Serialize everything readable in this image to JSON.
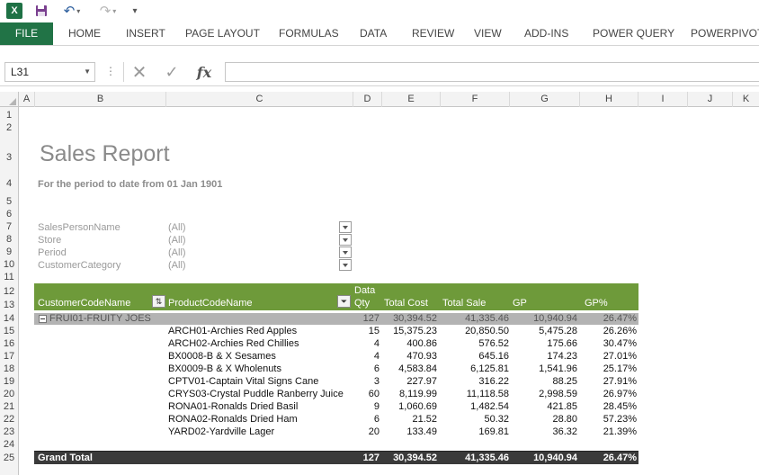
{
  "app": {
    "icon": "excel-icon",
    "excel_logo_letter": "X"
  },
  "ribbon": {
    "tabs": [
      "FILE",
      "HOME",
      "INSERT",
      "PAGE LAYOUT",
      "FORMULAS",
      "DATA",
      "REVIEW",
      "VIEW",
      "ADD-INS",
      "POWER QUERY",
      "POWERPIVOT"
    ]
  },
  "formula_bar": {
    "name_box": "L31",
    "formula": ""
  },
  "columns": [
    "A",
    "B",
    "C",
    "D",
    "E",
    "F",
    "G",
    "H",
    "I",
    "J",
    "K"
  ],
  "rows": [
    "1",
    "2",
    "3",
    "4",
    "5",
    "6",
    "7",
    "8",
    "9",
    "10",
    "11",
    "12",
    "13",
    "14",
    "15",
    "16",
    "17",
    "18",
    "19",
    "20",
    "21",
    "22",
    "23",
    "24",
    "25"
  ],
  "report": {
    "title": "Sales Report",
    "subtitle": "For the period to date from  01 Jan 1901"
  },
  "filters": [
    {
      "label": "SalesPersonName",
      "value": "(All)"
    },
    {
      "label": "Store",
      "value": "(All)"
    },
    {
      "label": "Period",
      "value": "(All)"
    },
    {
      "label": "CustomerCategory",
      "value": "(All)"
    }
  ],
  "pivot": {
    "data_label": "Data",
    "headers": {
      "customer": "CustomerCodeName",
      "product": "ProductCodeName",
      "qty": "Qty",
      "total_cost": "Total Cost",
      "total_sale": "Total Sale",
      "gp": "GP",
      "gp_pct": "GP%"
    },
    "group": {
      "name": "FRUI01-FRUITY JOES",
      "qty": "127",
      "total_cost": "30,394.52",
      "total_sale": "41,335.46",
      "gp": "10,940.94",
      "gp_pct": "26.47%"
    },
    "rows": [
      {
        "product": "ARCH01-Archies Red Apples",
        "qty": "15",
        "total_cost": "15,375.23",
        "total_sale": "20,850.50",
        "gp": "5,475.28",
        "gp_pct": "26.26%"
      },
      {
        "product": "ARCH02-Archies Red Chillies",
        "qty": "4",
        "total_cost": "400.86",
        "total_sale": "576.52",
        "gp": "175.66",
        "gp_pct": "30.47%"
      },
      {
        "product": "BX0008-B & X Sesames",
        "qty": "4",
        "total_cost": "470.93",
        "total_sale": "645.16",
        "gp": "174.23",
        "gp_pct": "27.01%"
      },
      {
        "product": "BX0009-B & X Wholenuts",
        "qty": "6",
        "total_cost": "4,583.84",
        "total_sale": "6,125.81",
        "gp": "1,541.96",
        "gp_pct": "25.17%"
      },
      {
        "product": "CPTV01-Captain Vital Signs Cane",
        "qty": "3",
        "total_cost": "227.97",
        "total_sale": "316.22",
        "gp": "88.25",
        "gp_pct": "27.91%"
      },
      {
        "product": "CRYS03-Crystal Puddle Ranberry Juice",
        "qty": "60",
        "total_cost": "8,119.99",
        "total_sale": "11,118.58",
        "gp": "2,998.59",
        "gp_pct": "26.97%"
      },
      {
        "product": "RONA01-Ronalds Dried Basil",
        "qty": "9",
        "total_cost": "1,060.69",
        "total_sale": "1,482.54",
        "gp": "421.85",
        "gp_pct": "28.45%"
      },
      {
        "product": "RONA02-Ronalds Dried Ham",
        "qty": "6",
        "total_cost": "21.52",
        "total_sale": "50.32",
        "gp": "28.80",
        "gp_pct": "57.23%"
      },
      {
        "product": "YARD02-Yardville Lager",
        "qty": "20",
        "total_cost": "133.49",
        "total_sale": "169.81",
        "gp": "36.32",
        "gp_pct": "21.39%"
      }
    ],
    "grand_total": {
      "label": "Grand Total",
      "qty": "127",
      "total_cost": "30,394.52",
      "total_sale": "41,335.46",
      "gp": "10,940.94",
      "gp_pct": "26.47%"
    }
  },
  "colors": {
    "ribbon_file": "#217346",
    "pivot_header": "#6e9a3a",
    "group_row": "#b3b3b3",
    "grand_total_row": "#3a3a3a"
  }
}
